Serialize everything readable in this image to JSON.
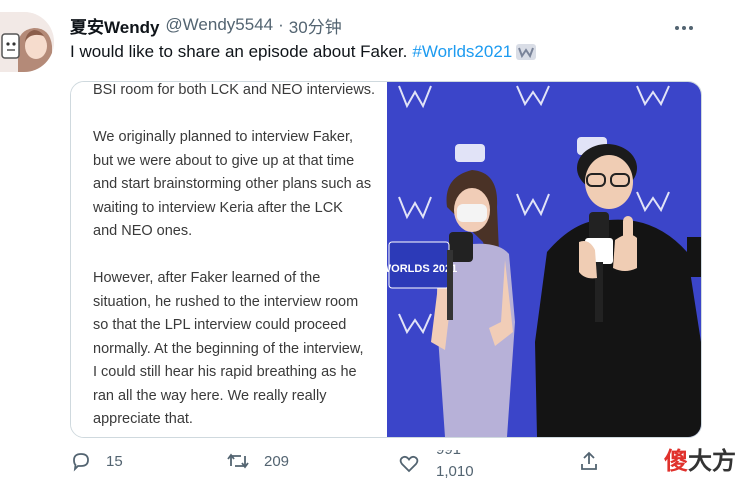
{
  "author": {
    "display_name": "夏安Wendy",
    "handle": "@Wendy5544",
    "separator": "·",
    "time": "30分钟"
  },
  "tweet": {
    "text": "I would like to share an episode about Faker.",
    "hashtag": "#Worlds2021"
  },
  "media": {
    "text_panel": {
      "paragraph_0": "BSI room for both LCK and NEO interviews.",
      "paragraph_1": "We originally planned to interview Faker,\nbut we were about to give up at that time\nand start brainstorming other plans such as\nwaiting to interview Keria after the LCK\nand NEO ones.",
      "paragraph_2": "However, after Faker learned of the\nsituation, he rushed to the interview room\nso that the LPL interview could proceed\nnormally. At the beginning of the interview,\nI could still hear his rapid breathing as he\nran all the way here. We really really\nappreciate that."
    },
    "photo": {
      "mic_flag_text": "WORLDS 2021",
      "background_color": "#3b45c9"
    }
  },
  "actions": {
    "reply_count": "15",
    "retweet_count": "209",
    "like_count": "1,010",
    "like_count_old": "991"
  },
  "watermark": {
    "first_char": "傻",
    "rest": "大方"
  },
  "colors": {
    "accent": "#1d9bf0",
    "secondary_text": "#536471",
    "primary_text": "#0f1419"
  },
  "icons": {
    "reply": "speech-bubble-icon",
    "retweet": "retweet-arrows-icon",
    "like": "heart-icon",
    "share": "upload-arrow-icon",
    "more": "ellipsis-icon",
    "emoji": "worlds-emoji-icon"
  }
}
